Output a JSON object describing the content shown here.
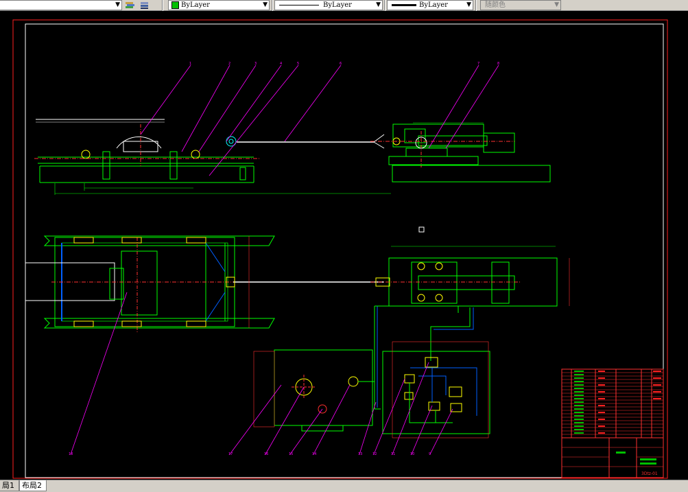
{
  "toolbar": {
    "color_label": "ByLayer",
    "linetype_label": "ByLayer",
    "lineweight_label": "ByLayer",
    "plotstyle_label": "随颜色",
    "accent_green": "#00c000"
  },
  "tabs": {
    "layout1": "局1",
    "layout2": "布局2"
  },
  "drawing": {
    "part_numbers": [
      "1",
      "2",
      "3",
      "4",
      "5",
      "6",
      "7",
      "8",
      "9",
      "10",
      "11",
      "12",
      "13",
      "14",
      "15",
      "16",
      "17",
      "18"
    ],
    "title_code": "3Dtz-01"
  }
}
